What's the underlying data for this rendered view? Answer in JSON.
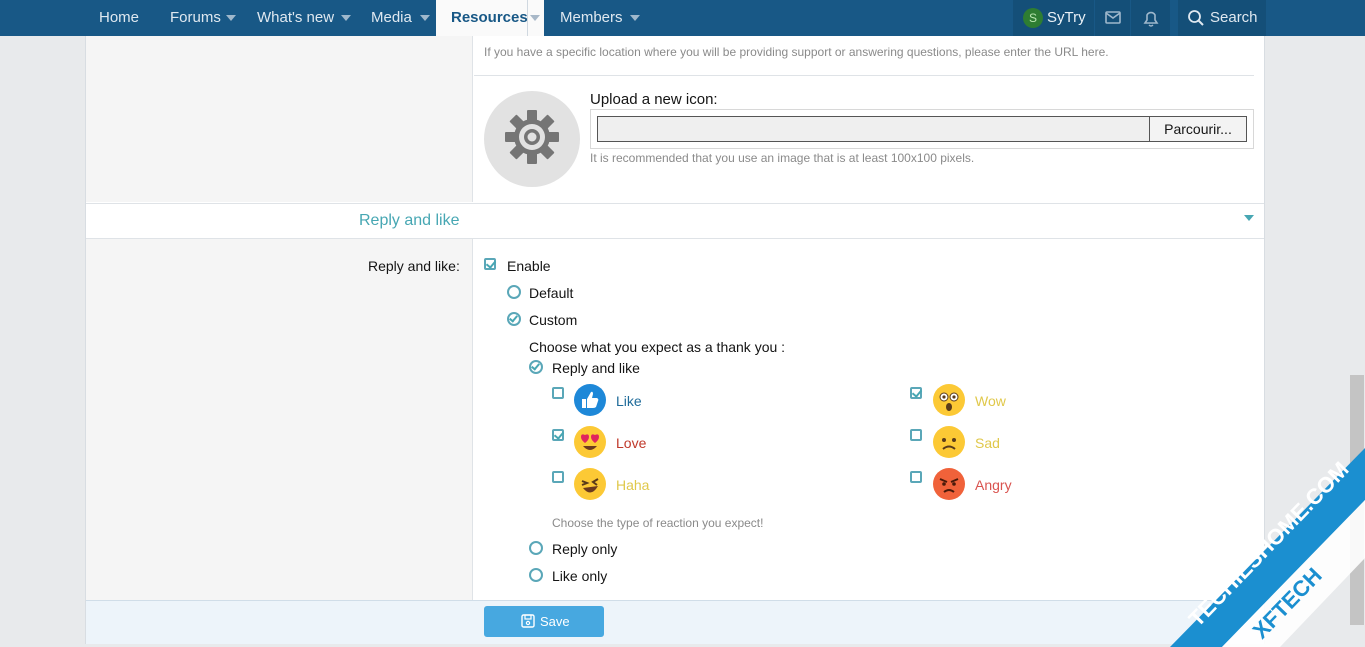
{
  "nav": {
    "items": [
      "Home",
      "Forums",
      "What's new",
      "Media",
      "Resources",
      "Members"
    ],
    "user_initial": "S",
    "user_name": "SyTry",
    "search_label": "Search"
  },
  "icon_section": {
    "location_hint": "If you have a specific location where you will be providing support or answering questions, please enter the URL here.",
    "upload_label": "Upload a new icon:",
    "browse_label": "Parcourir...",
    "upload_hint": "It is recommended that you use an image that is at least 100x100 pixels."
  },
  "section": {
    "title": "Reply and like"
  },
  "reply_like": {
    "field_label": "Reply and like:",
    "enable_label": "Enable",
    "enabled": true,
    "default_label": "Default",
    "custom_label": "Custom",
    "selected_mode": "Custom",
    "choose_label": "Choose what you expect as a thank you :",
    "option_reply_and_like": "Reply and like",
    "option_reply_only": "Reply only",
    "option_like_only": "Like only",
    "selected_option": "Reply and like",
    "reactions_hint": "Choose the type of reaction you expect!",
    "reactions": [
      {
        "label": "Like",
        "checked": false,
        "color": "#1f6b9a",
        "icon": "thumbs-up"
      },
      {
        "label": "Wow",
        "checked": true,
        "color": "#e0c84a",
        "icon": "wow-face"
      },
      {
        "label": "Love",
        "checked": true,
        "color": "#c0392b",
        "icon": "heart-eyes-face"
      },
      {
        "label": "Sad",
        "checked": false,
        "color": "#e0c84a",
        "icon": "sad-face"
      },
      {
        "label": "Haha",
        "checked": false,
        "color": "#e0c84a",
        "icon": "laughing-face"
      },
      {
        "label": "Angry",
        "checked": false,
        "color": "#d9534f",
        "icon": "angry-face"
      }
    ]
  },
  "footer": {
    "save_label": "Save"
  },
  "watermark": {
    "line1": "TECHIESHOME.COM",
    "line2": "XFTECH"
  },
  "colors": {
    "nav_bg": "#185886",
    "accent": "#47a7b3",
    "save_bg": "#47a8e0"
  }
}
